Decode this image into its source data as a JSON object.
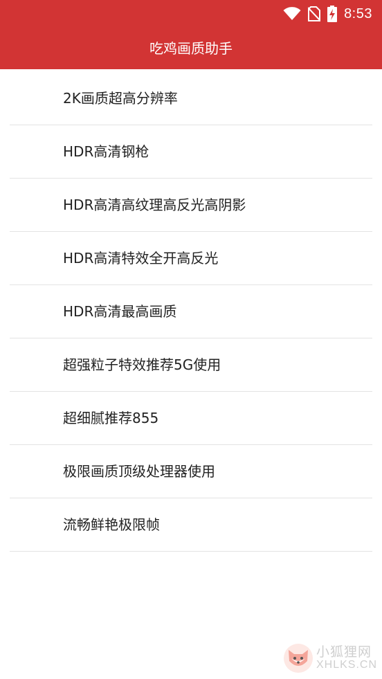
{
  "status_bar": {
    "time": "8:53",
    "icons": [
      "wifi-icon",
      "no-sim-icon",
      "battery-charging-icon"
    ]
  },
  "header": {
    "title": "吃鸡画质助手"
  },
  "menu": {
    "items": [
      {
        "label": "2K画质超高分辨率"
      },
      {
        "label": "HDR高清钢枪"
      },
      {
        "label": "HDR高清高纹理高反光高阴影"
      },
      {
        "label": "HDR高清特效全开高反光"
      },
      {
        "label": "HDR高清最高画质"
      },
      {
        "label": "超强粒子特效推荐5G使用"
      },
      {
        "label": "超细腻推荐855"
      },
      {
        "label": "极限画质顶级处理器使用"
      },
      {
        "label": "流畅鲜艳极限帧"
      }
    ]
  },
  "watermark": {
    "line1": "小狐狸网",
    "line2": "XHLKS.CN",
    "icon": "fox-logo-icon"
  },
  "colors": {
    "header_bg": "#d23434",
    "divider": "#e3e3e3"
  }
}
